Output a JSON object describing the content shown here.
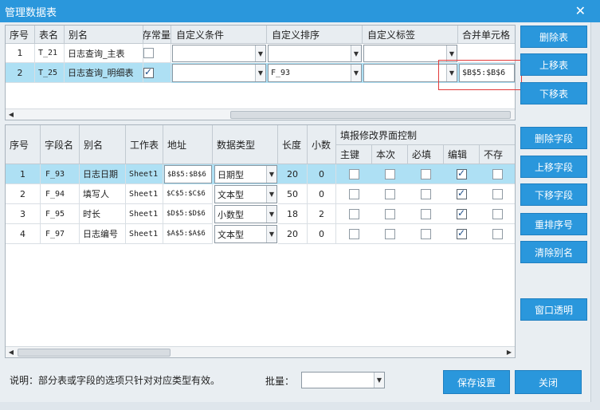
{
  "window": {
    "title": "管理数据表",
    "close_glyph": "✕"
  },
  "tables_grid": {
    "headers": [
      "序号",
      "表名",
      "别名",
      "存常量",
      "自定义条件",
      "自定义排序",
      "自定义标签",
      "合并单元格"
    ],
    "rows": [
      {
        "seq": "1",
        "name": "T_21",
        "alias": "日志查询_主表",
        "const": false,
        "cond": "",
        "sort": "",
        "label": "",
        "merge": "",
        "selected": false
      },
      {
        "seq": "2",
        "name": "T_25",
        "alias": "日志查询_明细表",
        "const": true,
        "cond": "",
        "sort": "F_93",
        "label": "",
        "merge": "$B$5:$B$6",
        "selected": true
      }
    ]
  },
  "table_buttons": {
    "delete": "删除表",
    "move_up": "上移表",
    "move_down": "下移表"
  },
  "fields_grid": {
    "headers": {
      "seq": "序号",
      "field": "字段名",
      "alias": "别名",
      "sheet": "工作表",
      "addr": "地址",
      "type": "数据类型",
      "len": "长度",
      "dec": "小数",
      "group": "填报修改界面控制",
      "pk": "主键",
      "cur": "本次",
      "req": "必填",
      "edit": "编辑",
      "nosave": "不存"
    },
    "rows": [
      {
        "seq": "1",
        "field": "F_93",
        "alias": "日志日期",
        "sheet": "Sheet1",
        "addr": "$B$5:$B$6",
        "type": "日期型",
        "len": "20",
        "dec": "0",
        "pk": false,
        "cur": false,
        "req": false,
        "edit": true,
        "nosave": false,
        "selected": true
      },
      {
        "seq": "2",
        "field": "F_94",
        "alias": "填写人",
        "sheet": "Sheet1",
        "addr": "$C$5:$C$6",
        "type": "文本型",
        "len": "50",
        "dec": "0",
        "pk": false,
        "cur": false,
        "req": false,
        "edit": true,
        "nosave": false,
        "selected": false
      },
      {
        "seq": "3",
        "field": "F_95",
        "alias": "时长",
        "sheet": "Sheet1",
        "addr": "$D$5:$D$6",
        "type": "小数型",
        "len": "18",
        "dec": "2",
        "pk": false,
        "cur": false,
        "req": false,
        "edit": true,
        "nosave": false,
        "selected": false
      },
      {
        "seq": "4",
        "field": "F_97",
        "alias": "日志编号",
        "sheet": "Sheet1",
        "addr": "$A$5:$A$6",
        "type": "文本型",
        "len": "20",
        "dec": "0",
        "pk": false,
        "cur": false,
        "req": false,
        "edit": true,
        "nosave": false,
        "selected": false
      }
    ]
  },
  "field_buttons": {
    "delete": "删除字段",
    "move_up": "上移字段",
    "move_down": "下移字段",
    "renumber": "重排序号",
    "clear_alias": "清除别名",
    "transparent": "窗口透明"
  },
  "footer": {
    "note": "说明：部分表或字段的选项只针对对应类型有效。",
    "batch_label": "批量：",
    "batch_value": "",
    "save": "保存设置",
    "close": "关闭"
  },
  "colors": {
    "accent": "#2a97dc",
    "selected_row": "#aee0f4",
    "highlight_box": "#e23a3a"
  }
}
